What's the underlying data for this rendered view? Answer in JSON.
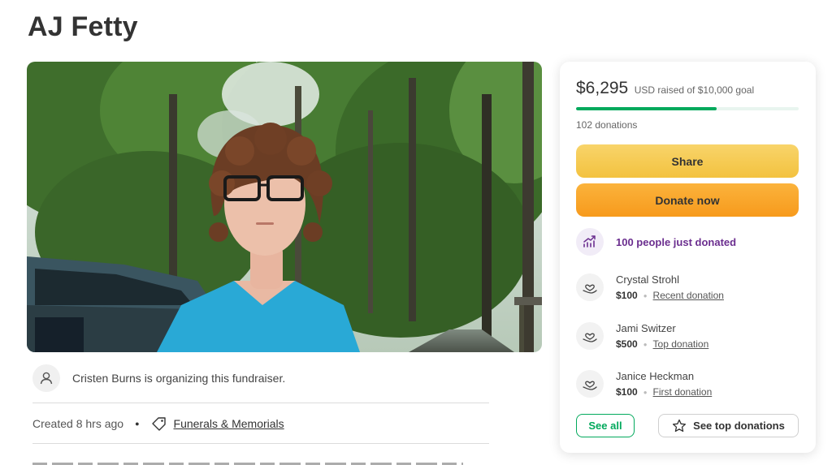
{
  "campaign": {
    "title": "AJ Fetty"
  },
  "organizer": {
    "text": "Cristen Burns is organizing this fundraiser."
  },
  "meta": {
    "created": "Created 8 hrs ago",
    "category": "Funerals & Memorials"
  },
  "donation_card": {
    "raised_amount": "$6,295",
    "raised_sub": "USD raised of $10,000 goal",
    "progress_fraction": 0.63,
    "donation_count": "102 donations",
    "share_label": "Share",
    "donate_label": "Donate now",
    "trend_text": "100 people just donated",
    "donors": [
      {
        "name": "Crystal Strohl",
        "amount": "$100",
        "tag": "Recent donation"
      },
      {
        "name": "Jami Switzer",
        "amount": "$500",
        "tag": "Top donation"
      },
      {
        "name": "Janice Heckman",
        "amount": "$100",
        "tag": "First donation"
      }
    ],
    "see_all_label": "See all",
    "see_top_label": "See top donations"
  },
  "colors": {
    "brand_green": "#02a95c",
    "share_yellow": "#f3c23f",
    "donate_orange": "#f79a1c",
    "trend_purple": "#6b2e8f"
  },
  "icons": {
    "organizer": "user-icon",
    "category": "tag-icon",
    "trend": "trending-up-icon",
    "donor": "heart-hand-icon",
    "top": "star-icon"
  }
}
